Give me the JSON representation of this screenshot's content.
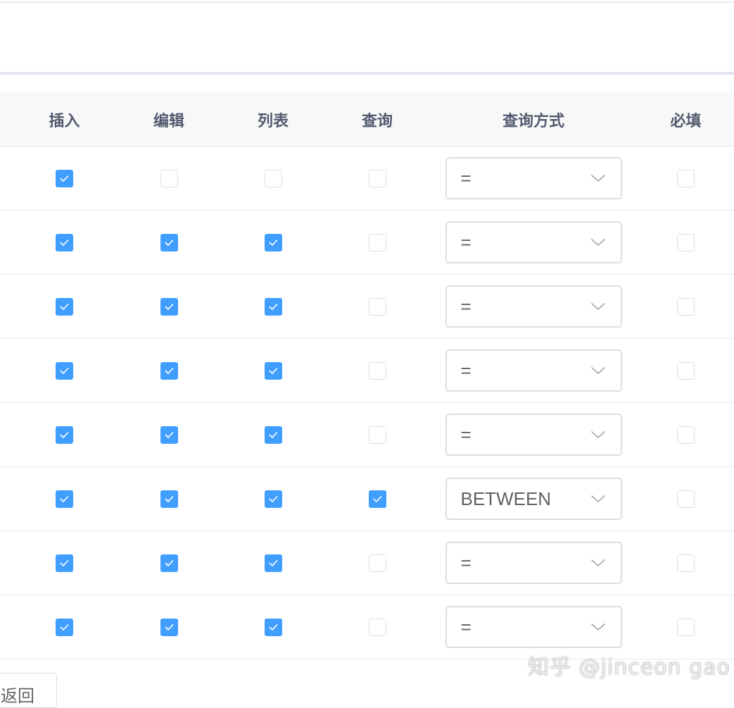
{
  "table": {
    "headers": [
      "插入",
      "编辑",
      "列表",
      "查询",
      "查询方式",
      "必填"
    ],
    "rows": [
      {
        "insert": true,
        "edit": false,
        "list": false,
        "query": false,
        "query_type": "=",
        "required": false
      },
      {
        "insert": true,
        "edit": true,
        "list": true,
        "query": false,
        "query_type": "=",
        "required": false
      },
      {
        "insert": true,
        "edit": true,
        "list": true,
        "query": false,
        "query_type": "=",
        "required": false
      },
      {
        "insert": true,
        "edit": true,
        "list": true,
        "query": false,
        "query_type": "=",
        "required": false
      },
      {
        "insert": true,
        "edit": true,
        "list": true,
        "query": false,
        "query_type": "=",
        "required": false
      },
      {
        "insert": true,
        "edit": true,
        "list": true,
        "query": true,
        "query_type": "BETWEEN",
        "required": false
      },
      {
        "insert": true,
        "edit": true,
        "list": true,
        "query": false,
        "query_type": "=",
        "required": false
      },
      {
        "insert": true,
        "edit": true,
        "list": true,
        "query": false,
        "query_type": "=",
        "required": false
      }
    ]
  },
  "footer": {
    "back_label": "返回"
  },
  "watermark": "知乎 @jinceon gao",
  "colors": {
    "checked": "#409eff",
    "border": "#dcdfe6",
    "header_bg": "#f8f8f9"
  }
}
